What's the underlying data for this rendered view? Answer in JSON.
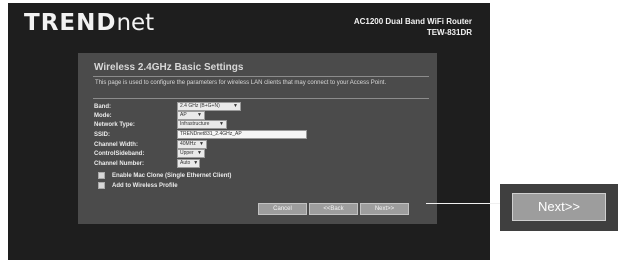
{
  "header": {
    "brand_main": "TREND",
    "brand_suffix": "net",
    "product_name": "AC1200 Dual Band WiFi Router",
    "model": "TEW-831DR"
  },
  "page": {
    "title": "Wireless 2.4GHz Basic Settings",
    "description": "This page is used to configure the parameters for wireless LAN clients that may connect to your Access Point."
  },
  "form": {
    "band": {
      "label": "Band:",
      "value": "2.4 GHz (B+G+N)"
    },
    "mode": {
      "label": "Mode:",
      "value": "AP"
    },
    "network_type": {
      "label": "Network Type:",
      "value": "Infrastructure"
    },
    "ssid": {
      "label": "SSID:",
      "value": "TRENDnet831_2.4GHz_AP"
    },
    "channel_width": {
      "label": "Channel Width:",
      "value": "40MHz"
    },
    "control_sideband": {
      "label": "ControlSideband:",
      "value": "Upper"
    },
    "channel_number": {
      "label": "Channel Number:",
      "value": "Auto"
    },
    "mac_clone": {
      "label": "Enable Mac Clone (Single Ethernet Client)",
      "checked": false
    },
    "wireless_profile": {
      "label": "Add to Wireless Profile",
      "checked": false
    }
  },
  "buttons": {
    "cancel": "Cancel",
    "back": "<<Back",
    "next": "Next>>"
  },
  "callout": {
    "next": "Next>>"
  }
}
